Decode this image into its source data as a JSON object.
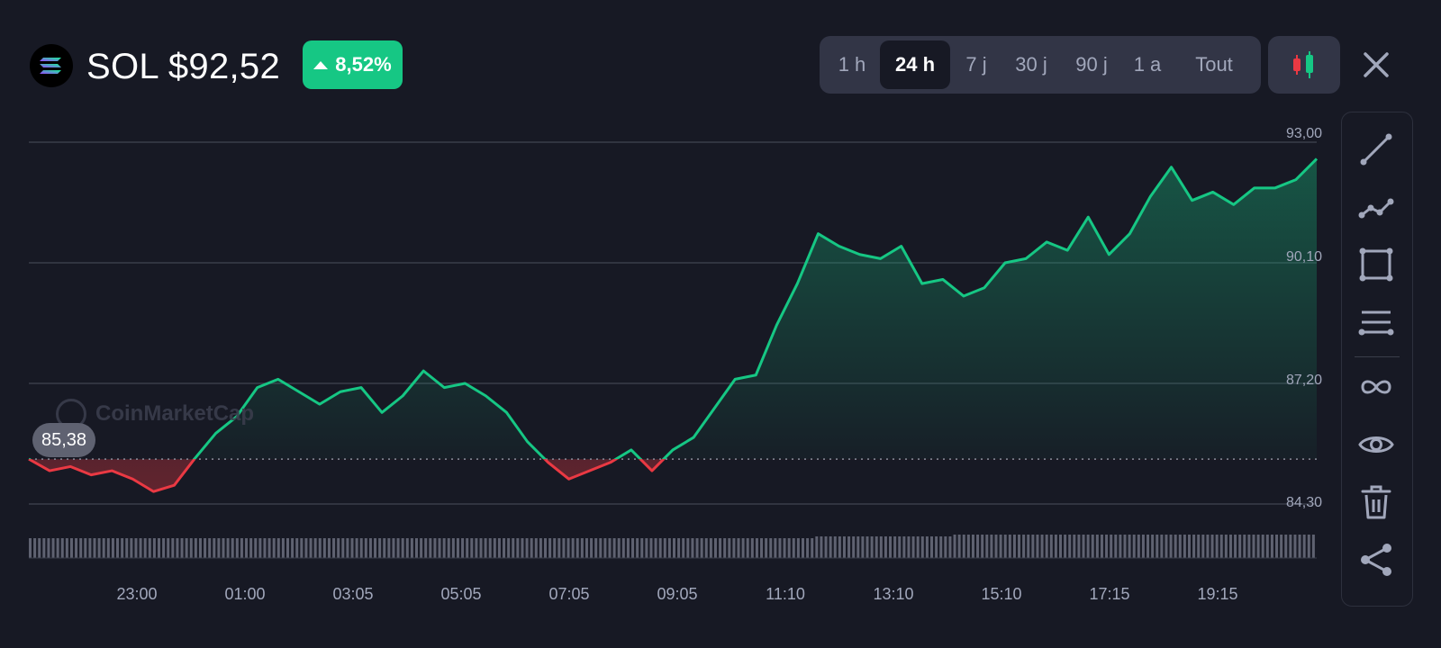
{
  "header": {
    "coin_icon": "solana-logo-icon",
    "title": "SOL $92,52",
    "change": "8,52%",
    "change_direction": "up",
    "change_color": "#16c784"
  },
  "ranges": {
    "items": [
      "1 h",
      "24 h",
      "7 j",
      "30 j",
      "90 j",
      "1 a",
      "Tout"
    ],
    "selected": "24 h"
  },
  "controls": {
    "chart_type_icon": "candlestick-icon",
    "close_icon": "close-icon"
  },
  "toolbar": {
    "tools": [
      "trend-line-icon",
      "polyline-icon",
      "rectangle-icon",
      "horizontal-lines-icon",
      "infinity-icon",
      "eye-icon",
      "trash-icon",
      "share-icon"
    ]
  },
  "watermark": "CoinMarketCap",
  "open_price_label": "85,38",
  "colors": {
    "up": "#16c784",
    "down": "#ea3943",
    "background": "#171924"
  },
  "chart_data": {
    "type": "area",
    "y_ticks": [
      "93,00",
      "90,10",
      "87,20",
      "84,30"
    ],
    "x_ticks": [
      "23:00",
      "01:00",
      "03:05",
      "05:05",
      "07:05",
      "09:05",
      "11:10",
      "13:10",
      "15:10",
      "17:15",
      "19:15"
    ],
    "baseline": 85.38,
    "ylim": [
      84.3,
      93.0
    ],
    "x": [
      0,
      0.5,
      1,
      1.5,
      2,
      2.5,
      3,
      3.5,
      4,
      4.5,
      5,
      5.5,
      6,
      6.5,
      7,
      7.5,
      8,
      8.5,
      9,
      9.5,
      10,
      10.5,
      11,
      11.5,
      12,
      12.5,
      13,
      13.5,
      14,
      14.5,
      15,
      15.5,
      16,
      16.5,
      17,
      17.5,
      18,
      18.5,
      19,
      19.5,
      20,
      20.5,
      21,
      21.5,
      22,
      22.5,
      23,
      23.5,
      24
    ],
    "values": [
      85.38,
      85.1,
      85.2,
      85.0,
      85.1,
      84.9,
      84.6,
      84.75,
      85.4,
      86.0,
      86.4,
      87.1,
      87.3,
      87.0,
      86.7,
      87.0,
      87.1,
      86.5,
      86.9,
      87.5,
      87.1,
      87.2,
      86.9,
      86.5,
      85.8,
      85.3,
      84.9,
      85.1,
      85.3,
      85.6,
      85.1,
      85.6,
      85.9,
      86.6,
      87.3,
      87.4,
      88.6,
      89.6,
      90.8,
      90.5,
      90.3,
      90.2,
      90.5,
      89.6,
      89.7,
      89.3,
      89.5,
      90.1,
      90.2,
      90.6,
      90.4,
      91.2,
      90.3,
      90.8,
      91.7,
      92.4,
      91.6,
      91.8,
      91.5,
      91.9,
      91.9,
      92.1,
      92.6
    ],
    "grid": true,
    "legend": "none"
  }
}
